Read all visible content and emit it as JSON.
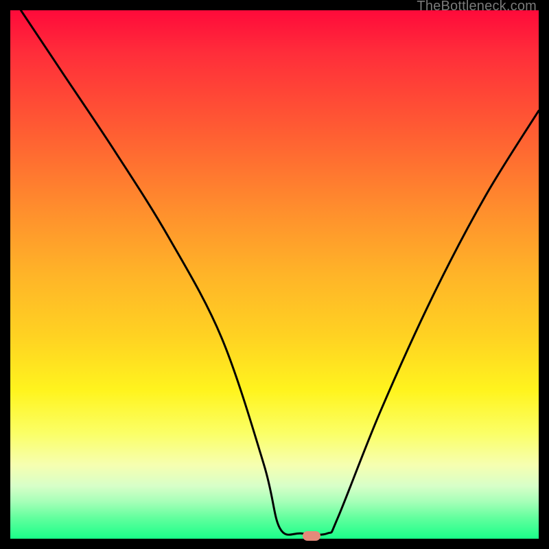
{
  "watermark": "TheBottleneck.com",
  "chart_data": {
    "type": "line",
    "title": "",
    "xlabel": "",
    "ylabel": "",
    "xlim": [
      0,
      100
    ],
    "ylim": [
      0,
      100
    ],
    "grid": false,
    "legend": false,
    "background_gradient": {
      "direction": "vertical",
      "stops": [
        {
          "pos": 0,
          "color": "#ff0a3a"
        },
        {
          "pos": 50,
          "color": "#ffb428"
        },
        {
          "pos": 80,
          "color": "#fbff66"
        },
        {
          "pos": 100,
          "color": "#1aff89"
        }
      ]
    },
    "series": [
      {
        "name": "bottleneck-curve",
        "x": [
          2,
          10,
          20,
          30,
          40,
          48,
          51,
          55,
          60,
          62,
          70,
          80,
          90,
          100
        ],
        "y": [
          100,
          88,
          73,
          57,
          38,
          14,
          2,
          1,
          1,
          4,
          24,
          46,
          65,
          81
        ],
        "color": "#000000",
        "linewidth": 3
      }
    ],
    "marker": {
      "name": "optimum-point",
      "x": 57,
      "y": 0.5,
      "color": "#e58a7a",
      "shape": "pill"
    }
  }
}
